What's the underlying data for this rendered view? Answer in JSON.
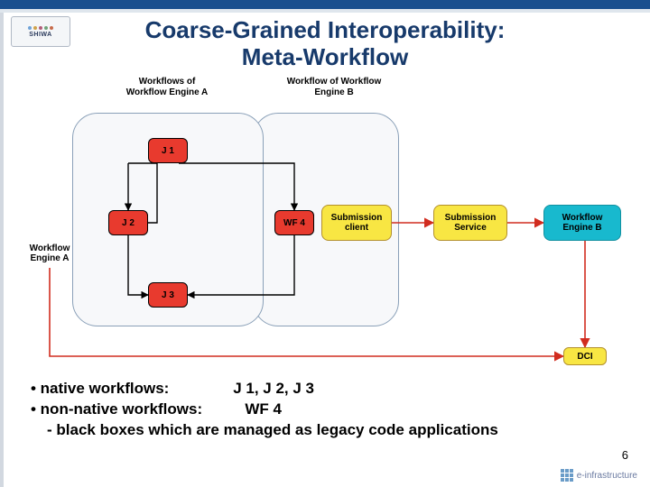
{
  "title_line1": "Coarse-Grained Interoperability:",
  "title_line2": "Meta-Workflow",
  "logo_text": "SHIWA",
  "labels": {
    "group_a": "Workflows of\nWorkflow Engine A",
    "group_b": "Workflow of Workflow\nEngine B"
  },
  "nodes": {
    "j1": "J 1",
    "j2": "J 2",
    "j3": "J 3",
    "wf4": "WF 4",
    "submission_client": "Submission\nclient",
    "submission_service": "Submission\nService",
    "workflow_engine_b": "Workflow\nEngine B",
    "workflow_engine_a": "Workflow\nEngine A",
    "dci": "DCI"
  },
  "bullets": {
    "line1a": "• native workflows:",
    "line1b": "J 1, J 2, J 3",
    "line2a": "• non-native workflows:",
    "line2b": "WF 4",
    "line3": "- black boxes which are managed as legacy code applications"
  },
  "page_number": "6",
  "footer": "e-infrastructure",
  "chart_data": {
    "type": "diagram",
    "title": "Coarse-Grained Interoperability: Meta-Workflow",
    "groups": [
      {
        "id": "engine_a_group",
        "label": "Workflows of Workflow Engine A",
        "contains": [
          "J1",
          "J2",
          "J3"
        ]
      },
      {
        "id": "engine_b_group",
        "label": "Workflow of Workflow Engine B",
        "contains": [
          "WF4",
          "SubmissionClient"
        ]
      }
    ],
    "nodes": [
      {
        "id": "J1",
        "label": "J 1",
        "color": "red"
      },
      {
        "id": "J2",
        "label": "J 2",
        "color": "red"
      },
      {
        "id": "J3",
        "label": "J 3",
        "color": "red"
      },
      {
        "id": "WF4",
        "label": "WF 4",
        "color": "red"
      },
      {
        "id": "SubmissionClient",
        "label": "Submission client",
        "color": "yellow"
      },
      {
        "id": "WorkflowEngineA",
        "label": "Workflow Engine A",
        "color": "none"
      },
      {
        "id": "SubmissionService",
        "label": "Submission Service",
        "color": "yellow"
      },
      {
        "id": "WorkflowEngineB",
        "label": "Workflow Engine B",
        "color": "cyan"
      },
      {
        "id": "DCI",
        "label": "DCI",
        "color": "yellow"
      }
    ],
    "edges": [
      {
        "from": "J1",
        "to": "J2",
        "color": "black"
      },
      {
        "from": "J1",
        "to": "WF4",
        "color": "black"
      },
      {
        "from": "J2",
        "to": "J3",
        "color": "black"
      },
      {
        "from": "WF4",
        "to": "J3",
        "color": "black"
      },
      {
        "from": "SubmissionClient",
        "to": "SubmissionService",
        "color": "red"
      },
      {
        "from": "SubmissionService",
        "to": "WorkflowEngineB",
        "color": "red"
      },
      {
        "from": "WorkflowEngineB",
        "to": "DCI",
        "color": "red"
      },
      {
        "from": "WorkflowEngineA",
        "to": "DCI",
        "color": "red",
        "path": "below"
      }
    ]
  }
}
